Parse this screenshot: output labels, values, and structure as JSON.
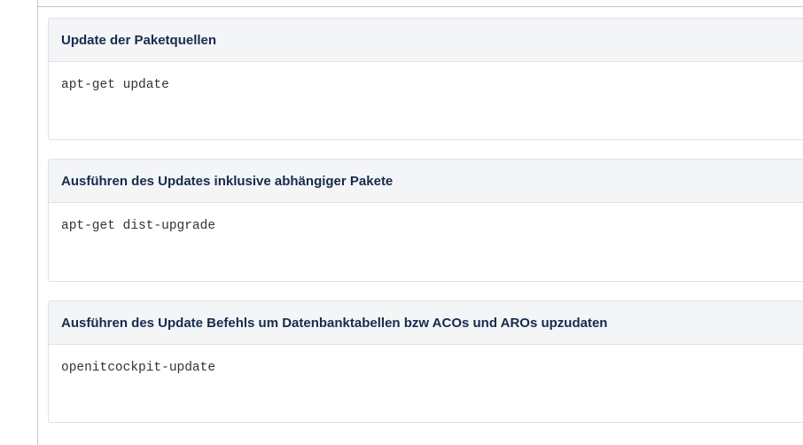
{
  "panels": [
    {
      "title": "Update der Paketquellen",
      "code": "apt-get update"
    },
    {
      "title": "Ausführen des Updates inklusive abhängiger Pakete",
      "code": "apt-get dist-upgrade"
    },
    {
      "title": "Ausführen des Update Befehls um Datenbanktabellen bzw ACOs und AROs upzudaten",
      "code": "openitcockpit-update"
    }
  ],
  "colors": {
    "header_background": "#f4f5f7",
    "border": "#dfe1e6",
    "title_text": "#172b4d",
    "code_text": "#333333"
  }
}
